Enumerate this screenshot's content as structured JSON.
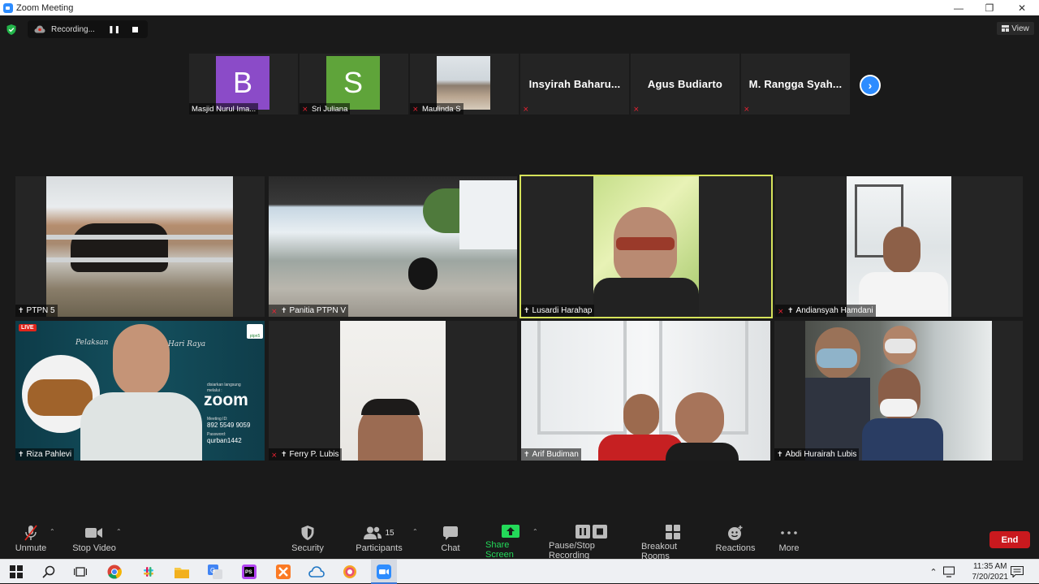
{
  "window": {
    "title": "Zoom Meeting"
  },
  "recording": {
    "label": "Recording..."
  },
  "view": {
    "label": "View"
  },
  "strip": [
    {
      "name": "Masjid Nurul Ima...",
      "initial": "B",
      "color": "#8b4bc8",
      "type": "avatar",
      "muted": false
    },
    {
      "name": "Sri Juliana",
      "initial": "S",
      "color": "#5fa43a",
      "type": "avatar",
      "muted": true
    },
    {
      "name": "Maulinda S",
      "type": "video",
      "muted": true
    },
    {
      "name": "Insyirah Baharu...",
      "type": "name",
      "muted": true
    },
    {
      "name": "Agus Budiarto",
      "type": "name",
      "muted": true
    },
    {
      "name": "M. Rangga Syah...",
      "type": "name",
      "muted": true
    }
  ],
  "grid": [
    {
      "name": "PTPN 5",
      "muted": false,
      "pinned": true
    },
    {
      "name": "Panitia PTPN V",
      "muted": true,
      "pinned": true
    },
    {
      "name": "Lusardi Harahap",
      "muted": false,
      "pinned": true,
      "active": true
    },
    {
      "name": "Andiansyah Hamdani",
      "muted": true,
      "pinned": true
    },
    {
      "name": "Riza Pahlevi",
      "muted": false,
      "pinned": true,
      "live": "LIVE"
    },
    {
      "name": "Ferry P. Lubis",
      "muted": true,
      "pinned": true
    },
    {
      "name": "Arif Budiman",
      "muted": false,
      "pinned": true
    },
    {
      "name": "Abdi Hurairah Lubis",
      "muted": false,
      "pinned": true
    }
  ],
  "slide": {
    "line1a": "Pelaksan",
    "line1b": "Hari Raya",
    "brand": "zoom",
    "small1": "disiarkan langsung",
    "small2": "melalui :",
    "meeting_label": "Meeting ID:",
    "meeting_id": "892 5549 9059",
    "pass_label": "Password:",
    "password": "qurban1442",
    "logo": "ptpn5"
  },
  "toolbar": {
    "unmute": "Unmute",
    "stop_video": "Stop Video",
    "security": "Security",
    "participants": "Participants",
    "participants_count": "15",
    "chat": "Chat",
    "share": "Share Screen",
    "pause_record": "Pause/Stop Recording",
    "breakout": "Breakout Rooms",
    "reactions": "Reactions",
    "more": "More",
    "end": "End"
  },
  "taskbar": {
    "time": "11:35 AM",
    "date": "7/20/2021"
  },
  "colors": {
    "share_green": "#23d959",
    "end_red": "#c9191e",
    "active_border": "#d6e35a",
    "accent": "#2d8cff"
  }
}
